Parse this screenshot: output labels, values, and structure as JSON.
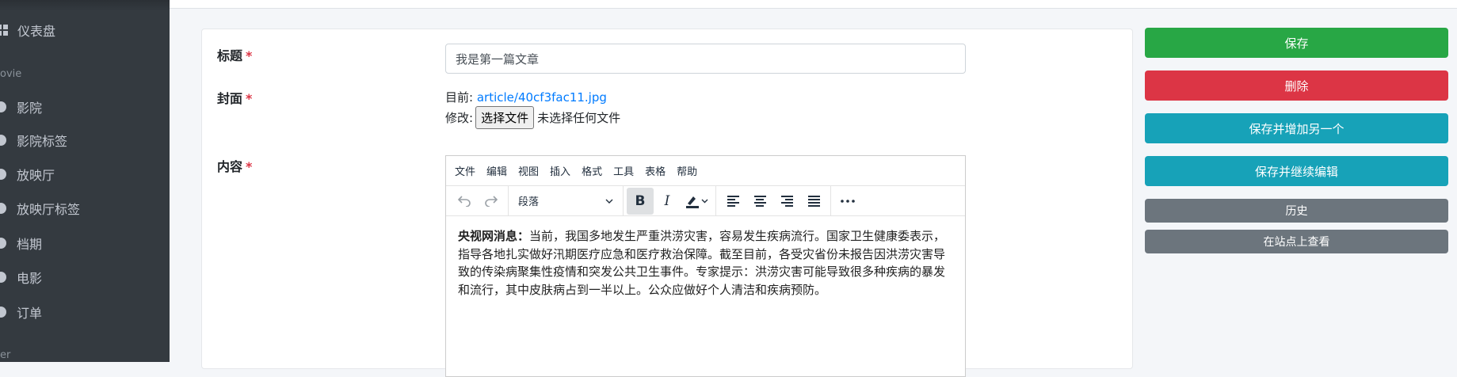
{
  "sidebar": {
    "dashboard": "仪表盘",
    "section_movie": "ovie",
    "items": [
      "影院",
      "影院标签",
      "放映厅",
      "放映厅标签",
      "档期",
      "电影",
      "订单"
    ],
    "section_user": "er"
  },
  "form": {
    "title_label": "标题",
    "title_value": "我是第一篇文章",
    "cover_label": "封面",
    "cover_current_prefix": "目前:",
    "cover_current_link": "article/40cf3fac11.jpg",
    "cover_change_prefix": "修改:",
    "file_button": "选择文件",
    "file_status": "未选择任何文件",
    "content_label": "内容",
    "required_mark": "*"
  },
  "editor": {
    "menus": [
      "文件",
      "编辑",
      "视图",
      "插入",
      "格式",
      "工具",
      "表格",
      "帮助"
    ],
    "block_format": "段落",
    "content_lead": "央视网消息：",
    "content_body": "当前，我国多地发生严重洪涝灾害，容易发生疾病流行。国家卫生健康委表示，指导各地扎实做好汛期医疗应急和医疗救治保障。截至目前，各受灾省份未报告因洪涝灾害导致的传染病聚集性疫情和突发公共卫生事件。专家提示：洪涝灾害可能导致很多种疾病的暴发和流行，其中皮肤病占到一半以上。公众应做好个人清洁和疾病预防。"
  },
  "actions": {
    "save": "保存",
    "delete": "删除",
    "save_add": "保存并增加另一个",
    "save_continue": "保存并继续编辑",
    "history": "历史",
    "view_on_site": "在站点上查看"
  },
  "colors": {
    "sidebar_bg": "#343a40",
    "save": "#28a745",
    "delete": "#dc3545",
    "teal": "#17a2b8",
    "gray": "#6c757d",
    "link": "#007bff"
  }
}
